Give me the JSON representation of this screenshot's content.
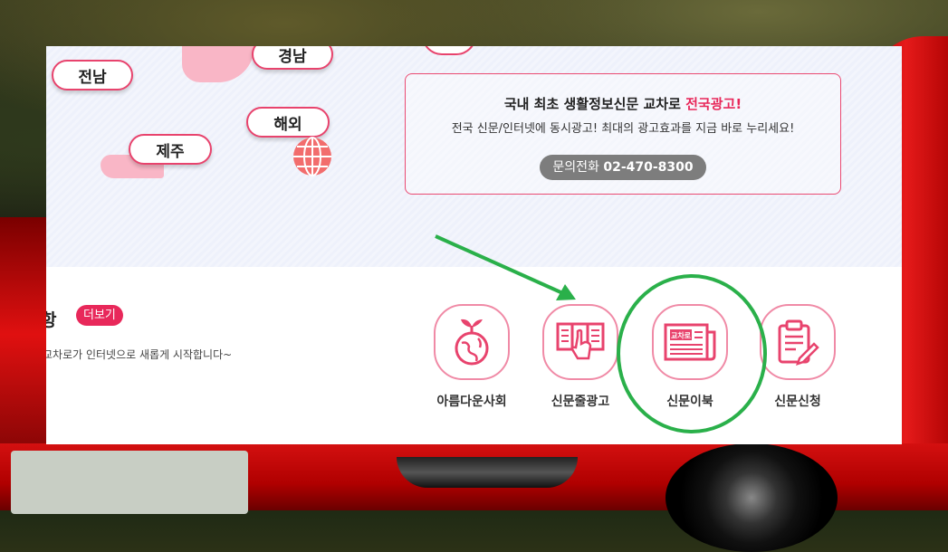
{
  "map": {
    "regions": [
      "경남",
      "전남",
      "해외",
      "제주"
    ]
  },
  "info": {
    "title_prefix": "국내 최초 생활정보신문 교차로 ",
    "title_highlight": "전국광고!",
    "subtitle": "전국 신문/인터넷에 동시광고! 최대의 광고효과를 지금 바로 누리세요!",
    "phone_label": "문의전화 ",
    "phone_number": "02-470-8300"
  },
  "news": {
    "heading": "항",
    "more_label": "더보기",
    "line": "교차로가 인터넷으로 새롭게 시작합니다~"
  },
  "menu": [
    {
      "label": "아름다운사회",
      "icon": "globe-plant-icon"
    },
    {
      "label": "신문줄광고",
      "icon": "newspaper-ad-hand-icon"
    },
    {
      "label": "신문이북",
      "icon": "newspaper-icon",
      "icon_text": "교차로"
    },
    {
      "label": "신문신청",
      "icon": "clipboard-pen-icon"
    }
  ],
  "colors": {
    "accent": "#e8285a",
    "icon_line": "#e8436d",
    "annotation": "#2ab04a"
  }
}
